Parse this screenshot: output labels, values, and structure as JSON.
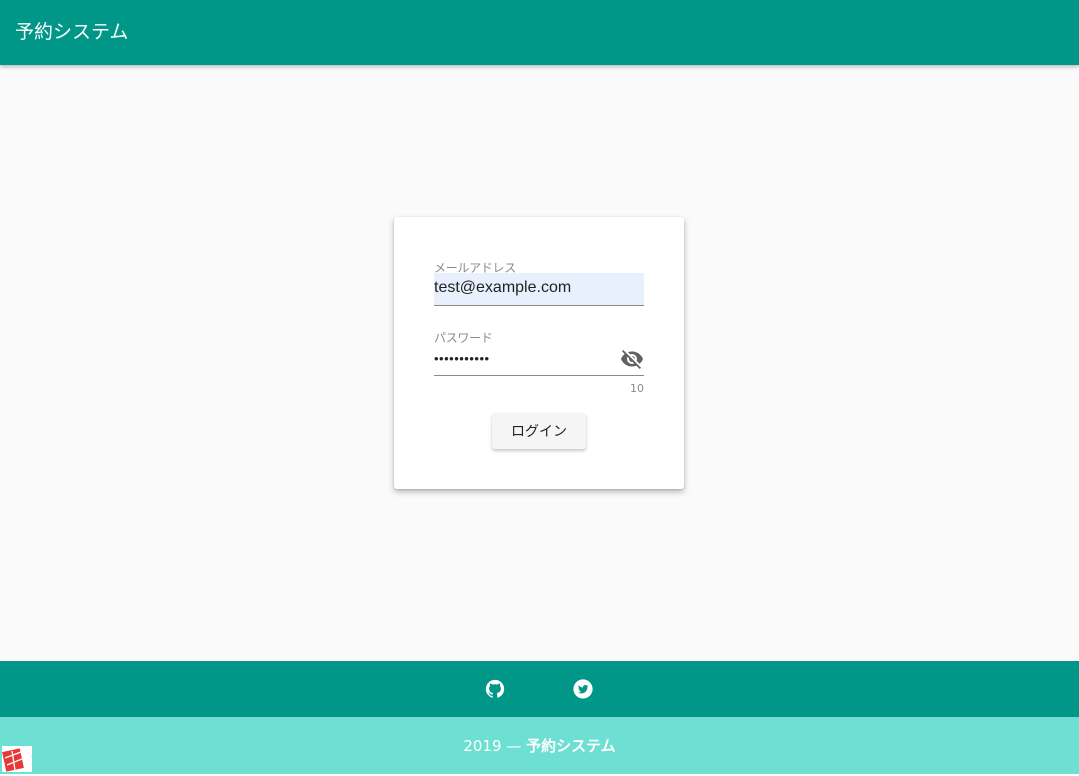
{
  "app": {
    "title": "予約システム"
  },
  "login_form": {
    "email_label": "メールアドレス",
    "email_value": "test@example.com",
    "password_label": "パスワード",
    "password_value": "testtest123",
    "password_counter": "10",
    "login_button": "ログイン"
  },
  "icons": {
    "visibility_toggle": "eye-off-icon",
    "github": "github-icon",
    "twitter": "twitter-icon"
  },
  "footer": {
    "year": "2019",
    "separator": "—",
    "name": "予約システム"
  },
  "colors": {
    "primary": "#009688",
    "footer_light": "#6ddfd3",
    "background": "#fafafa"
  }
}
